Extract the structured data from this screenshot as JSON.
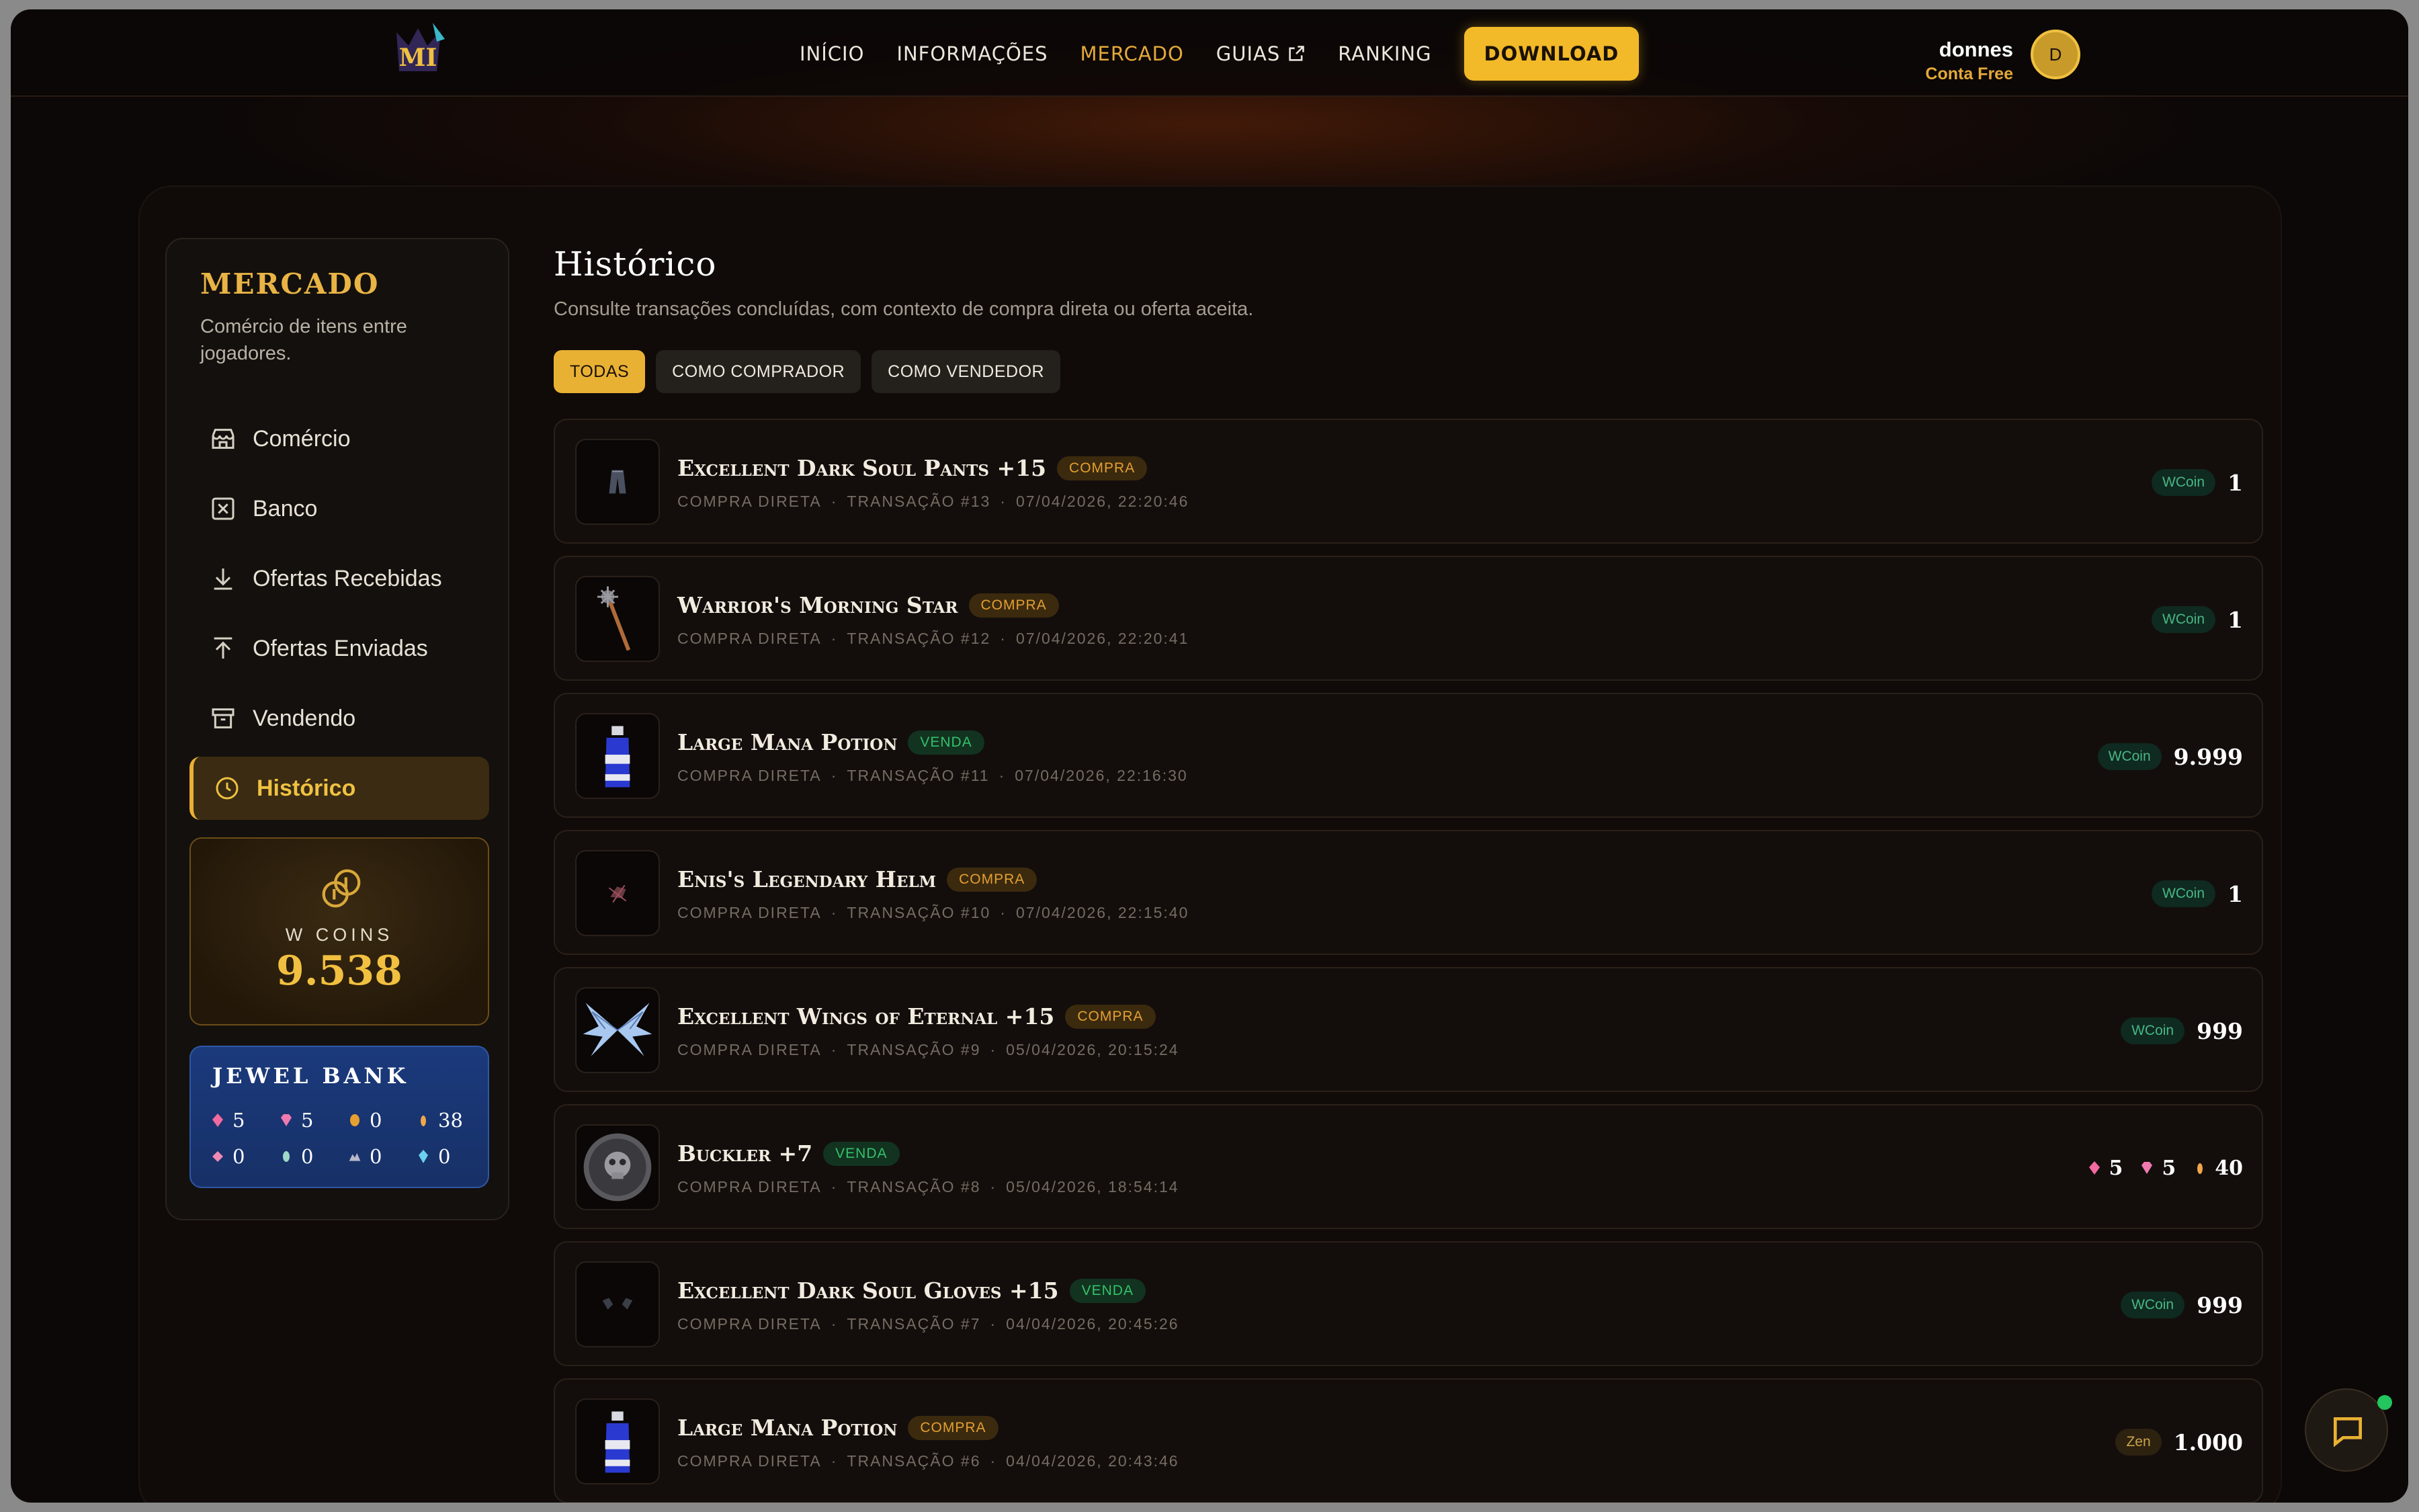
{
  "nav": {
    "items": [
      "INÍCIO",
      "INFORMAÇÕES",
      "MERCADO",
      "GUIAS",
      "RANKING"
    ],
    "download_label": "DOWNLOAD"
  },
  "user": {
    "name": "donnes",
    "plan": "Conta Free",
    "initial": "D"
  },
  "sidebar": {
    "title": "MERCADO",
    "subtitle": "Comércio de itens entre jogadores.",
    "items": [
      {
        "label": "Comércio",
        "icon": "store-icon"
      },
      {
        "label": "Banco",
        "icon": "bank-icon"
      },
      {
        "label": "Ofertas Recebidas",
        "icon": "download-icon"
      },
      {
        "label": "Ofertas Enviadas",
        "icon": "upload-icon"
      },
      {
        "label": "Vendendo",
        "icon": "archive-icon"
      },
      {
        "label": "Histórico",
        "icon": "clock-icon"
      }
    ],
    "wcoins": {
      "label": "W COINS",
      "value": "9.538"
    },
    "jewel_bank": {
      "title": "JEWEL BANK",
      "row1": [
        "5",
        "5",
        "0",
        "38"
      ],
      "row2": [
        "0",
        "0",
        "0",
        "0"
      ]
    }
  },
  "main": {
    "title": "Histórico",
    "description": "Consulte transações concluídas, com contexto de compra direta ou oferta aceita.",
    "filters": [
      "TODAS",
      "COMO COMPRADOR",
      "COMO VENDEDOR"
    ],
    "transactions": [
      {
        "name": "Excellent Dark Soul Pants +15",
        "type": "COMPRA",
        "mode": "COMPRA DIRETA",
        "tx": "TRANSAÇÃO #13",
        "date": "07/04/2026, 22:20:46",
        "currency": "WCoin",
        "amount": "1",
        "icon": "pants-icon"
      },
      {
        "name": "Warrior's Morning Star",
        "type": "COMPRA",
        "mode": "COMPRA DIRETA",
        "tx": "TRANSAÇÃO #12",
        "date": "07/04/2026, 22:20:41",
        "currency": "WCoin",
        "amount": "1",
        "icon": "mace-icon"
      },
      {
        "name": "Large Mana Potion",
        "type": "VENDA",
        "mode": "COMPRA DIRETA",
        "tx": "TRANSAÇÃO #11",
        "date": "07/04/2026, 22:16:30",
        "currency": "WCoin",
        "amount": "9.999",
        "icon": "potion-icon"
      },
      {
        "name": "Enis's Legendary Helm",
        "type": "COMPRA",
        "mode": "COMPRA DIRETA",
        "tx": "TRANSAÇÃO #10",
        "date": "07/04/2026, 22:15:40",
        "currency": "WCoin",
        "amount": "1",
        "icon": "helm-icon"
      },
      {
        "name": "Excellent Wings of Eternal +15",
        "type": "COMPRA",
        "mode": "COMPRA DIRETA",
        "tx": "TRANSAÇÃO #9",
        "date": "05/04/2026, 20:15:24",
        "currency": "WCoin",
        "amount": "999",
        "icon": "wings-icon"
      },
      {
        "name": "Buckler +7",
        "type": "VENDA",
        "mode": "COMPRA DIRETA",
        "tx": "TRANSAÇÃO #8",
        "date": "05/04/2026, 18:54:14",
        "jewels": [
          "5",
          "5",
          "40"
        ],
        "icon": "shield-icon"
      },
      {
        "name": "Excellent Dark Soul Gloves +15",
        "type": "VENDA",
        "mode": "COMPRA DIRETA",
        "tx": "TRANSAÇÃO #7",
        "date": "04/04/2026, 20:45:26",
        "currency": "WCoin",
        "amount": "999",
        "icon": "gloves-icon"
      },
      {
        "name": "Large Mana Potion",
        "type": "COMPRA",
        "mode": "COMPRA DIRETA",
        "tx": "TRANSAÇÃO #6",
        "date": "04/04/2026, 20:43:46",
        "currency": "Zen",
        "amount": "1.000",
        "icon": "potion-icon"
      }
    ]
  },
  "colors": {
    "accent": "#e9b133",
    "compra": "#e49f32",
    "venda": "#34c16a",
    "background": "#0c0807"
  }
}
